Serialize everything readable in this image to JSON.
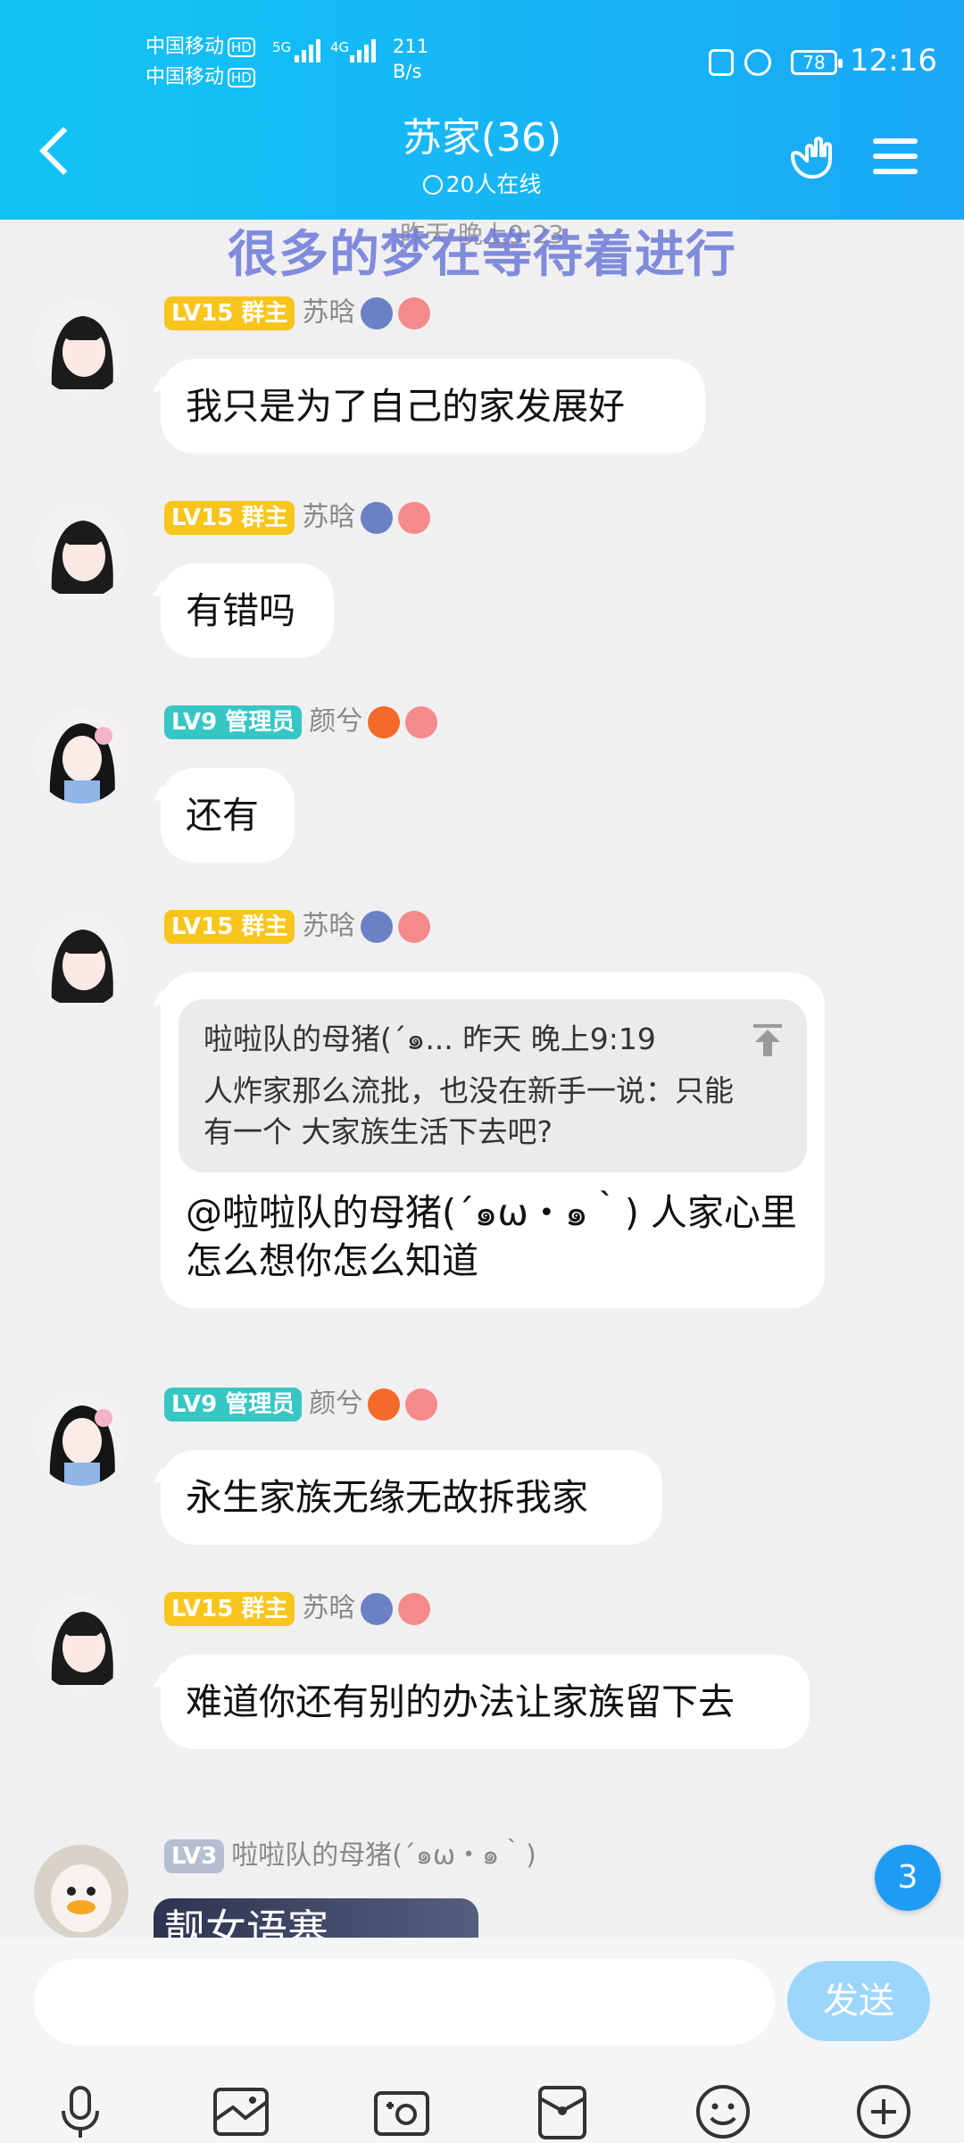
{
  "status_bar": {
    "carrier1": "中国移动",
    "carrier2": "中国移动",
    "hd": "HD",
    "net1": "5G",
    "net2": "4G",
    "speed_value": "211",
    "speed_unit": "B/s",
    "battery": "78",
    "time": "12:16"
  },
  "header": {
    "title": "苏家(36)",
    "online": "20人在线"
  },
  "timestamp": "昨天 晚上9:23",
  "banner": "很多的梦在等待着进行",
  "messages": [
    {
      "level": "LV15",
      "role": "群主",
      "name": "苏晗",
      "text": "我只是为了自己的家发展好"
    },
    {
      "level": "LV15",
      "role": "群主",
      "name": "苏晗",
      "text": "有错吗"
    },
    {
      "level": "LV9",
      "role": "管理员",
      "name": "颜兮",
      "text": "还有"
    },
    {
      "level": "LV15",
      "role": "群主",
      "name": "苏晗",
      "quote_header": "啦啦队的母猪(´๑... 昨天 晚上9:19",
      "quote_text": "人炸家那么流批，也没在新手一说：只能有一个 大家族生活下去吧?",
      "text": "@啦啦队的母猪(´๑ω・๑｀) 人家心里怎么想你怎么知道"
    },
    {
      "level": "LV9",
      "role": "管理员",
      "name": "颜兮",
      "text": "永生家族无缘无故拆我家"
    },
    {
      "level": "LV15",
      "role": "群主",
      "name": "苏晗",
      "text": "难道你还有别的办法让家族留下去"
    },
    {
      "level": "LV3",
      "name": "啦啦队的母猪(´๑ω・๑｀)",
      "image_text": "靓女语塞"
    }
  ],
  "unread_count": "3",
  "input": {
    "send_label": "发送"
  },
  "toolbar": [
    "microphone-icon",
    "picture-icon",
    "camera-icon",
    "red-packet-icon",
    "emoji-icon",
    "plus-icon"
  ]
}
